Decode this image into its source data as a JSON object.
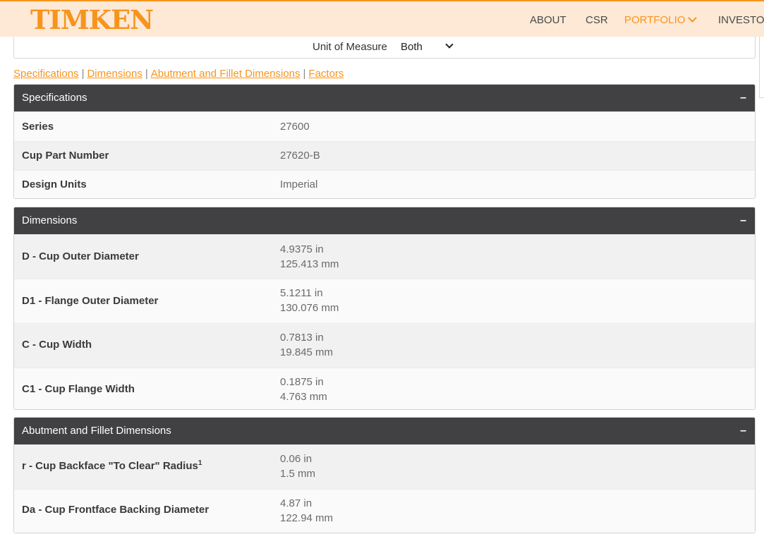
{
  "header": {
    "logo": "TIMKEN",
    "nav": [
      {
        "label": "ABOUT"
      },
      {
        "label": "CSR"
      },
      {
        "label": "PORTFOLIO"
      },
      {
        "label": "INVESTOR"
      }
    ],
    "active_color": "#f7941d"
  },
  "unit_of_measure": {
    "label": "Unit of Measure",
    "selected": "Both"
  },
  "section_links": [
    {
      "label": "Specifications"
    },
    {
      "label": "Dimensions"
    },
    {
      "label": "Abutment and Fillet Dimensions"
    },
    {
      "label": "Factors"
    }
  ],
  "collapse_symbol": "–",
  "specifications": {
    "title": "Specifications",
    "rows": [
      {
        "label": "Series",
        "value": "27600"
      },
      {
        "label": "Cup Part Number",
        "value": "27620-B"
      },
      {
        "label": "Design Units",
        "value": "Imperial"
      }
    ]
  },
  "dimensions": {
    "title": "Dimensions",
    "rows": [
      {
        "label": "D - Cup Outer Diameter",
        "in": "4.9375 in",
        "mm": "125.413 mm"
      },
      {
        "label": "D1 - Flange Outer Diameter",
        "in": "5.1211 in",
        "mm": "130.076 mm"
      },
      {
        "label": "C - Cup Width",
        "in": "0.7813 in",
        "mm": "19.845 mm"
      },
      {
        "label": "C1 - Cup Flange Width",
        "in": "0.1875 in",
        "mm": "4.763 mm"
      }
    ]
  },
  "abutment": {
    "title": "Abutment and Fillet Dimensions",
    "rows": [
      {
        "label": "r - Cup Backface \"To Clear\" Radius",
        "sup": "1",
        "in": "0.06 in",
        "mm": "1.5 mm"
      },
      {
        "label": "Da - Cup Frontface Backing Diameter",
        "in": "4.87 in",
        "mm": "122.94 mm"
      }
    ]
  }
}
